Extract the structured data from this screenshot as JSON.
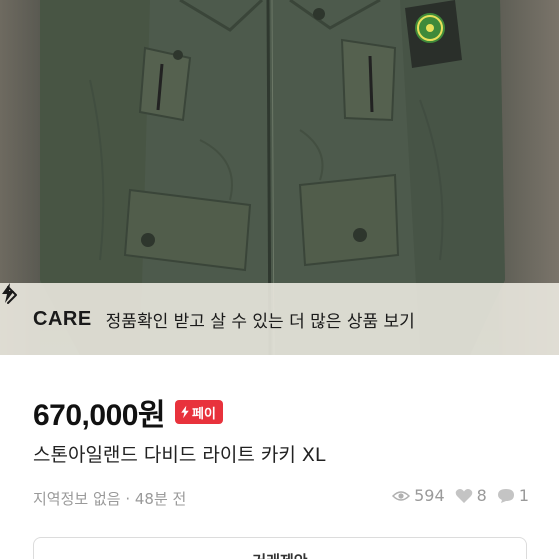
{
  "care_banner": {
    "brand": "CARE",
    "text": "정품확인 받고 살 수 있는 더 많은 상품 보기"
  },
  "product": {
    "price": "670,000원",
    "pay_badge": "페이",
    "title": "스톤아일랜드 다비드 라이트 카키 XL",
    "meta": "지역정보 없음 · 48분 전",
    "views": "594",
    "likes": "8",
    "chats": "1"
  },
  "bottom_button": {
    "label": "거래제안"
  },
  "colors": {
    "accent": "#e8323c",
    "jacket": "#4a5649"
  }
}
